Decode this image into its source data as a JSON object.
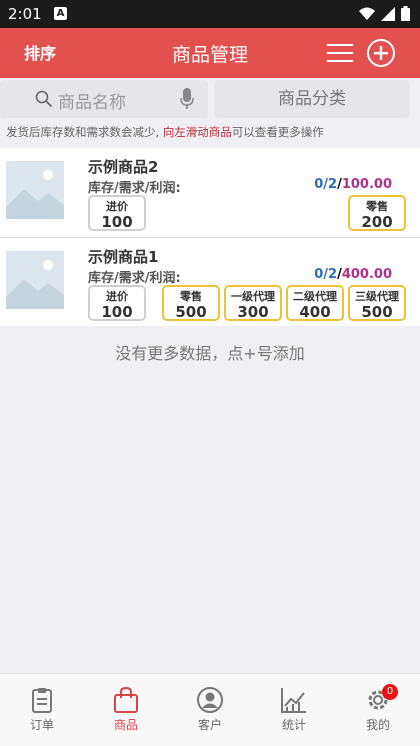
{
  "status": {
    "time": "2:01",
    "a_badge": "A"
  },
  "header": {
    "sort_label": "排序",
    "title": "商品管理"
  },
  "search": {
    "placeholder": "商品名称",
    "category_label": "商品分类"
  },
  "hint": {
    "prefix": "发货后库存数和需求数会减少, ",
    "highlight": "向左滑动商品",
    "suffix": "可以查看更多操作"
  },
  "products": [
    {
      "name": "示例商品2",
      "label": "库存/需求/利润:",
      "stock": "0",
      "demand": "2",
      "profit": "100.00",
      "buy": {
        "label": "进价",
        "value": "100"
      },
      "prices": [
        {
          "label": "零售",
          "value": "200"
        }
      ]
    },
    {
      "name": "示例商品1",
      "label": "库存/需求/利润:",
      "stock": "0",
      "demand": "2",
      "profit": "400.00",
      "buy": {
        "label": "进价",
        "value": "100"
      },
      "prices": [
        {
          "label": "零售",
          "value": "500"
        },
        {
          "label": "一级代理",
          "value": "300"
        },
        {
          "label": "二级代理",
          "value": "400"
        },
        {
          "label": "三级代理",
          "value": "500"
        }
      ]
    }
  ],
  "no_more": "没有更多数据，点+号添加",
  "tabs": [
    {
      "label": "订单",
      "icon": "clipboard-icon"
    },
    {
      "label": "商品",
      "icon": "shopping-bag-icon"
    },
    {
      "label": "客户",
      "icon": "user-icon"
    },
    {
      "label": "统计",
      "icon": "chart-icon"
    },
    {
      "label": "我的",
      "icon": "gear-icon",
      "badge": "0"
    }
  ],
  "colors": {
    "accent": "#e25050",
    "active_tab": "#d94545",
    "highlight_border": "#eac33b"
  }
}
